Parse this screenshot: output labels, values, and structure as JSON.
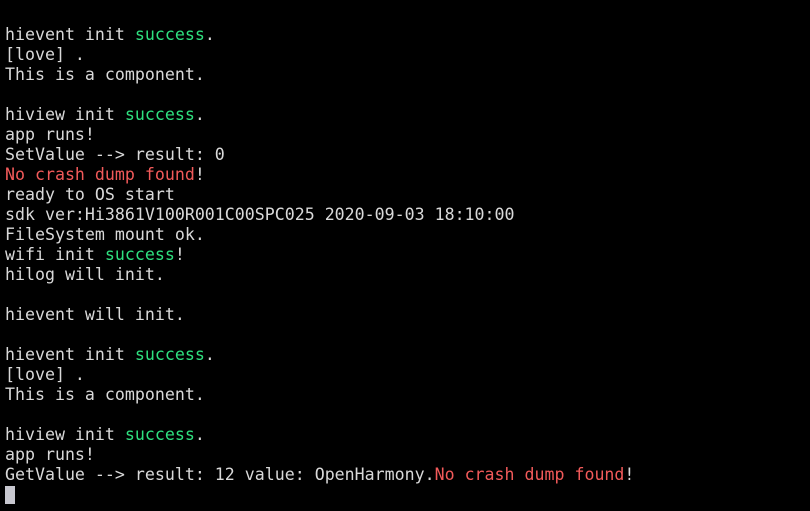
{
  "terminal": {
    "colors": {
      "background": "#000000",
      "text": "#d9d9d9",
      "success": "#2ee07f",
      "error": "#f25a5a",
      "cursor": "#c8c8d0"
    },
    "lines": [
      {
        "segments": [
          {
            "text": "hievent init "
          },
          {
            "text": "success",
            "style": "ok"
          },
          {
            "text": "."
          }
        ]
      },
      {
        "segments": [
          {
            "text": "[love] ."
          }
        ]
      },
      {
        "segments": [
          {
            "text": "This is a component."
          }
        ]
      },
      {
        "segments": [
          {
            "text": ""
          }
        ]
      },
      {
        "segments": [
          {
            "text": "hiview init "
          },
          {
            "text": "success",
            "style": "ok"
          },
          {
            "text": "."
          }
        ]
      },
      {
        "segments": [
          {
            "text": "app runs!"
          }
        ]
      },
      {
        "segments": [
          {
            "text": "SetValue --> result: 0"
          }
        ]
      },
      {
        "segments": [
          {
            "text": "No crash dump found",
            "style": "err"
          },
          {
            "text": "!"
          }
        ]
      },
      {
        "segments": [
          {
            "text": "ready to OS start"
          }
        ]
      },
      {
        "segments": [
          {
            "text": "sdk ver:Hi3861V100R001C00SPC025 2020-09-03 18:10:00"
          }
        ]
      },
      {
        "segments": [
          {
            "text": "FileSystem mount ok."
          }
        ]
      },
      {
        "segments": [
          {
            "text": "wifi init "
          },
          {
            "text": "success",
            "style": "ok"
          },
          {
            "text": "!"
          }
        ]
      },
      {
        "segments": [
          {
            "text": "hilog will init."
          }
        ]
      },
      {
        "segments": [
          {
            "text": ""
          }
        ]
      },
      {
        "segments": [
          {
            "text": "hievent will init."
          }
        ]
      },
      {
        "segments": [
          {
            "text": ""
          }
        ]
      },
      {
        "segments": [
          {
            "text": "hievent init "
          },
          {
            "text": "success",
            "style": "ok"
          },
          {
            "text": "."
          }
        ]
      },
      {
        "segments": [
          {
            "text": "[love] ."
          }
        ]
      },
      {
        "segments": [
          {
            "text": "This is a component."
          }
        ]
      },
      {
        "segments": [
          {
            "text": ""
          }
        ]
      },
      {
        "segments": [
          {
            "text": "hiview init "
          },
          {
            "text": "success",
            "style": "ok"
          },
          {
            "text": "."
          }
        ]
      },
      {
        "segments": [
          {
            "text": "app runs!"
          }
        ]
      },
      {
        "segments": [
          {
            "text": "GetValue --> result: 12 value: OpenHarmony."
          },
          {
            "text": "No crash dump found",
            "style": "err"
          },
          {
            "text": "!"
          }
        ]
      }
    ],
    "cursor_icon": "block-cursor"
  }
}
